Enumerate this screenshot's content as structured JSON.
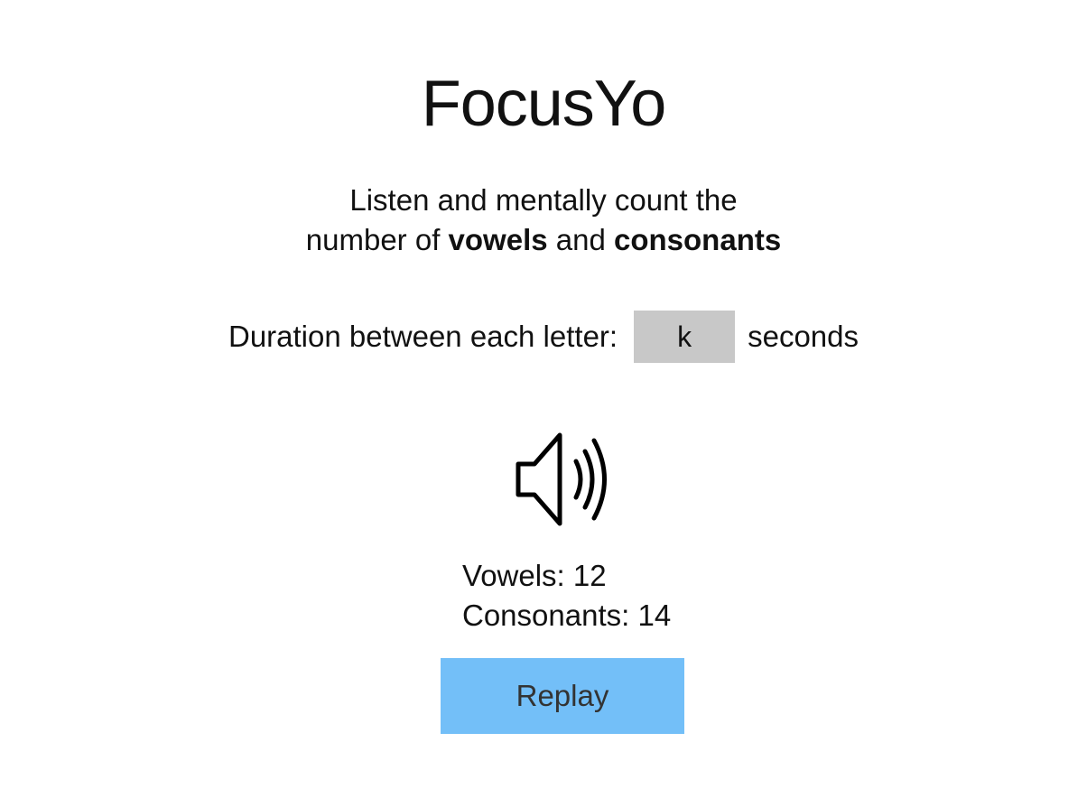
{
  "app": {
    "title": "FocusYo"
  },
  "instructions": {
    "line1": "Listen and mentally count the",
    "line2_pre": "number of ",
    "line2_bold1": "vowels",
    "line2_mid": " and ",
    "line2_bold2": "consonants"
  },
  "duration": {
    "label": "Duration between each letter:",
    "value": "k",
    "unit": "seconds"
  },
  "speaker": {
    "icon": "speaker-volume-icon"
  },
  "results": {
    "vowels_label": "Vowels:",
    "vowels_value": "12",
    "consonants_label": "Consonants:",
    "consonants_value": "14"
  },
  "replay": {
    "label": "Replay",
    "color": "#73bff8"
  }
}
